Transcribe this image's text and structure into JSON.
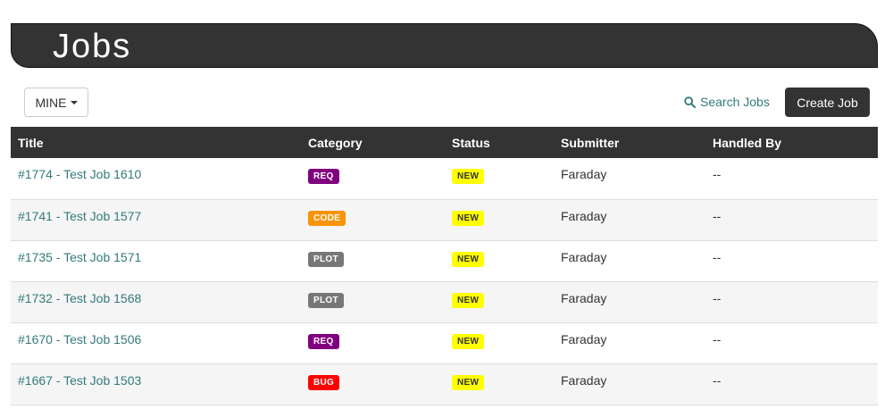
{
  "header": {
    "title": "Jobs"
  },
  "toolbar": {
    "filter_label": "MINE",
    "search_label": "Search Jobs",
    "create_label": "Create Job"
  },
  "table": {
    "headers": [
      "Title",
      "Category",
      "Status",
      "Submitter",
      "Handled By"
    ],
    "rows": [
      {
        "title": "#1774 - Test Job 1610",
        "category": "REQ",
        "category_color": "#800080",
        "status": "NEW",
        "submitter": "Faraday",
        "handled_by": "--"
      },
      {
        "title": "#1741 - Test Job 1577",
        "category": "CODE",
        "category_color": "#f89406",
        "status": "NEW",
        "submitter": "Faraday",
        "handled_by": "--"
      },
      {
        "title": "#1735 - Test Job 1571",
        "category": "PLOT",
        "category_color": "#777777",
        "status": "NEW",
        "submitter": "Faraday",
        "handled_by": "--"
      },
      {
        "title": "#1732 - Test Job 1568",
        "category": "PLOT",
        "category_color": "#777777",
        "status": "NEW",
        "submitter": "Faraday",
        "handled_by": "--"
      },
      {
        "title": "#1670 - Test Job 1506",
        "category": "REQ",
        "category_color": "#800080",
        "status": "NEW",
        "submitter": "Faraday",
        "handled_by": "--"
      },
      {
        "title": "#1667 - Test Job 1503",
        "category": "BUG",
        "category_color": "#ff0000",
        "status": "NEW",
        "submitter": "Faraday",
        "handled_by": "--"
      }
    ]
  },
  "colors": {
    "header_bg": "#333333",
    "link": "#337a7a",
    "status_badge": "#ffff00"
  },
  "icons": {
    "search": "search-icon",
    "caret": "caret-down-icon"
  }
}
